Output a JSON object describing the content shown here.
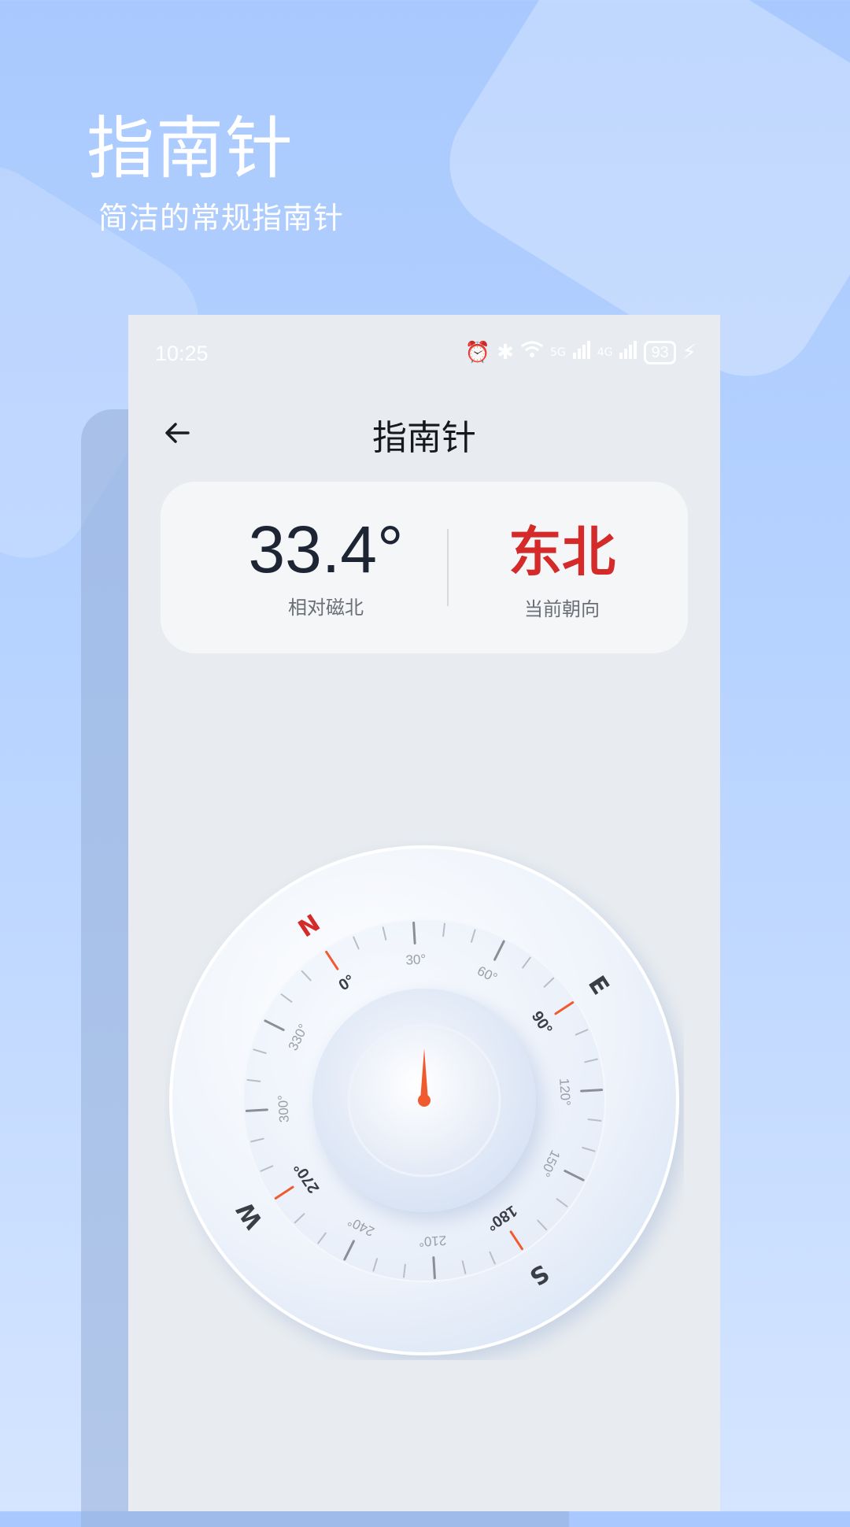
{
  "hero": {
    "title": "指南针",
    "subtitle": "简洁的常规指南针"
  },
  "status_bar": {
    "time": "10:25",
    "network_1": "5G",
    "network_2": "4G",
    "battery": "93"
  },
  "nav": {
    "title": "指南针"
  },
  "info_card": {
    "angle_value": "33.4°",
    "angle_label": "相对磁北",
    "direction_value": "东北",
    "direction_label": "当前朝向"
  },
  "compass": {
    "heading_deg": 33.4,
    "cardinals": [
      {
        "letter": "N",
        "deg": 0,
        "color": "#d42a2a"
      },
      {
        "letter": "E",
        "deg": 90,
        "color": "#3a3f47"
      },
      {
        "letter": "S",
        "deg": 180,
        "color": "#3a3f47"
      },
      {
        "letter": "W",
        "deg": 270,
        "color": "#3a3f47"
      }
    ],
    "degree_labels": [
      "0°",
      "30°",
      "60°",
      "90°",
      "120°",
      "150°",
      "180°",
      "210°",
      "240°",
      "270°",
      "300°",
      "330°"
    ],
    "accent_color": "#f05a2e",
    "needle_color": "#f05a2e"
  },
  "icons": [
    "back-arrow-icon",
    "alarm-icon",
    "bluetooth-icon",
    "wifi-icon",
    "signal-icon",
    "battery-icon",
    "charging-icon"
  ]
}
